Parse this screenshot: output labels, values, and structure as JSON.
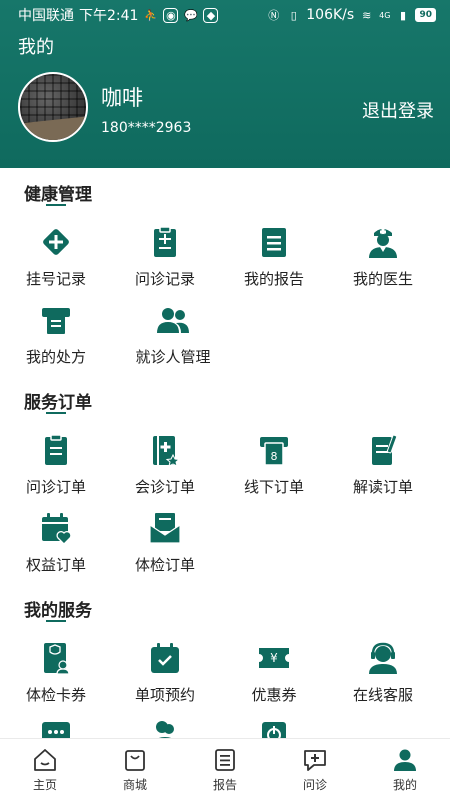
{
  "status_bar": {
    "carrier": "中国联通",
    "time": "下午2:41",
    "speed": "106K/s",
    "network": "4G",
    "battery": "90"
  },
  "header": {
    "title": "我的",
    "user_name": "咖啡",
    "phone": "180****2963",
    "logout_label": "退出登录"
  },
  "sections": {
    "health": {
      "title": "健康管理",
      "items": [
        {
          "label": "挂号记录",
          "icon": "diamond-plus-icon"
        },
        {
          "label": "问诊记录",
          "icon": "clipboard-icon"
        },
        {
          "label": "我的报告",
          "icon": "report-icon"
        },
        {
          "label": "我的医生",
          "icon": "doctor-icon"
        },
        {
          "label": "我的处方",
          "icon": "prescription-icon"
        },
        {
          "label": "就诊人管理",
          "icon": "patients-icon"
        }
      ]
    },
    "orders": {
      "title": "服务订单",
      "items": [
        {
          "label": "问诊订单",
          "icon": "clipboard-icon"
        },
        {
          "label": "会诊订单",
          "icon": "medical-book-icon"
        },
        {
          "label": "线下订单",
          "icon": "ticket-machine-icon"
        },
        {
          "label": "解读订单",
          "icon": "note-icon"
        },
        {
          "label": "权益订单",
          "icon": "calendar-heart-icon"
        },
        {
          "label": "体检订单",
          "icon": "envelope-icon"
        }
      ]
    },
    "services": {
      "title": "我的服务",
      "items": [
        {
          "label": "体检卡券",
          "icon": "card-icon"
        },
        {
          "label": "单项预约",
          "icon": "calendar-check-icon"
        },
        {
          "label": "优惠券",
          "icon": "coupon-icon"
        },
        {
          "label": "在线客服",
          "icon": "headset-icon"
        }
      ]
    }
  },
  "tabbar": {
    "items": [
      {
        "label": "主页",
        "icon": "home-icon"
      },
      {
        "label": "商城",
        "icon": "shopping-bag-icon"
      },
      {
        "label": "报告",
        "icon": "report-list-icon"
      },
      {
        "label": "问诊",
        "icon": "chat-plus-icon"
      },
      {
        "label": "我的",
        "icon": "user-icon"
      }
    ]
  },
  "colors": {
    "brand": "#0f6a5e",
    "header_top": "#17776a",
    "text": "#222222"
  }
}
